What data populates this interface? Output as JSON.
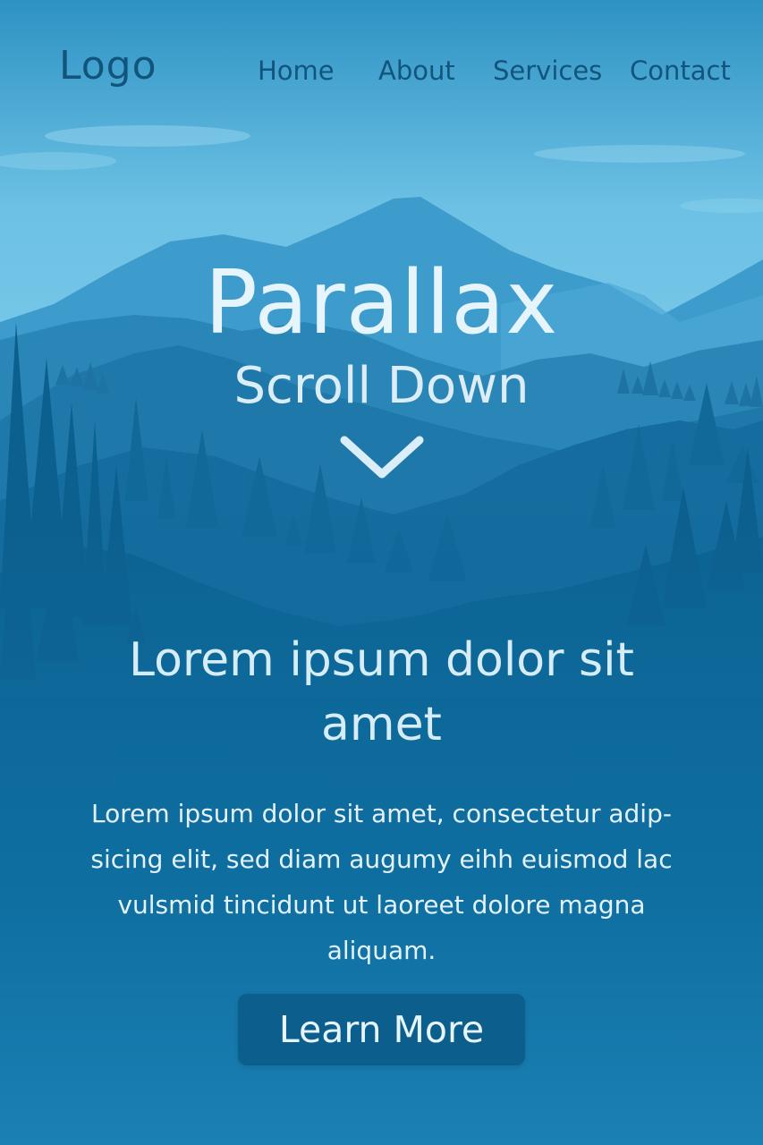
{
  "header": {
    "logo": "Logo",
    "nav": [
      {
        "label": "Home"
      },
      {
        "label": "About"
      },
      {
        "label": "Services"
      },
      {
        "label": "Contact"
      }
    ]
  },
  "hero": {
    "title": "Parallax",
    "subtitle": "Scroll Down",
    "scroll_icon": "chevron-down-icon"
  },
  "content": {
    "heading": "Lorem ipsum dolor sit amet",
    "body": "Lorem ipsum dolor sit amet, consectetur adip-sicing elit, sed diam augumy eihh euismod lac vulsmid tincidunt ut laoreet dolore magna aliquam.",
    "button_label": "Learn More"
  },
  "colors": {
    "sky": "#5db8de",
    "nav_text": "#12557c",
    "button_bg": "#0c5f8d",
    "text_light": "#e6f4fb"
  }
}
